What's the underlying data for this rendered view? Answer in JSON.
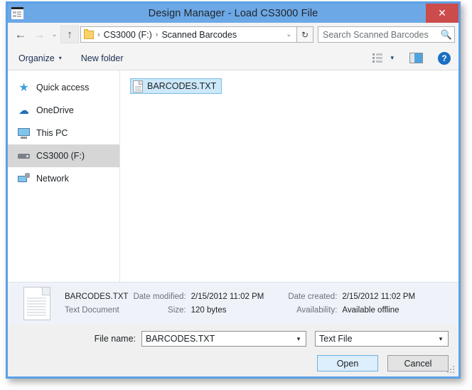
{
  "window": {
    "title": "Design Manager - Load CS3000 File",
    "app_icon": "window-document-icon",
    "close_label": "✕"
  },
  "nav": {
    "back": "←",
    "forward": "→",
    "history_caret": "⌄",
    "up": "↑",
    "refresh": "↻",
    "breadcrumb": {
      "separator": "›",
      "items": [
        {
          "label": "CS3000 (F:)"
        },
        {
          "label": "Scanned Barcodes"
        }
      ],
      "dropdown_caret": "⌄"
    }
  },
  "search": {
    "placeholder": "Search Scanned Barcodes",
    "value": "",
    "icon": "search-icon"
  },
  "toolbar": {
    "organize_label": "Organize",
    "organize_caret": "▾",
    "new_folder_label": "New folder",
    "view_caret": "▾",
    "help_label": "?"
  },
  "sidebar": {
    "items": [
      {
        "label": "Quick access",
        "icon": "star-icon",
        "selected": false
      },
      {
        "label": "OneDrive",
        "icon": "cloud-icon",
        "selected": false
      },
      {
        "label": "This PC",
        "icon": "monitor-icon",
        "selected": false
      },
      {
        "label": "CS3000 (F:)",
        "icon": "drive-icon",
        "selected": true
      },
      {
        "label": "Network",
        "icon": "network-icon",
        "selected": false
      }
    ]
  },
  "filelist": {
    "items": [
      {
        "name": "BARCODES.TXT",
        "icon": "text-file-icon",
        "selected": true
      }
    ]
  },
  "details": {
    "file_name": "BARCODES.TXT",
    "file_type": "Text Document",
    "date_modified_label": "Date modified:",
    "date_modified_value": "2/15/2012 11:02 PM",
    "size_label": "Size:",
    "size_value": "120 bytes",
    "date_created_label": "Date created:",
    "date_created_value": "2/15/2012 11:02 PM",
    "availability_label": "Availability:",
    "availability_value": "Available offline"
  },
  "footer": {
    "filename_label": "File name:",
    "filename_value": "BARCODES.TXT",
    "filetype_value": "Text File",
    "combo_caret": "▾",
    "open_label": "Open",
    "cancel_label": "Cancel"
  },
  "colors": {
    "titlebar": "#6da8e6",
    "window_border": "#5ba0e8",
    "close_button": "#cc4c4c",
    "selection": "#cce8f9",
    "sidebar_selected": "#d6d6d6",
    "details_bg": "#eff3f9",
    "accent_link": "#1a2d52"
  }
}
